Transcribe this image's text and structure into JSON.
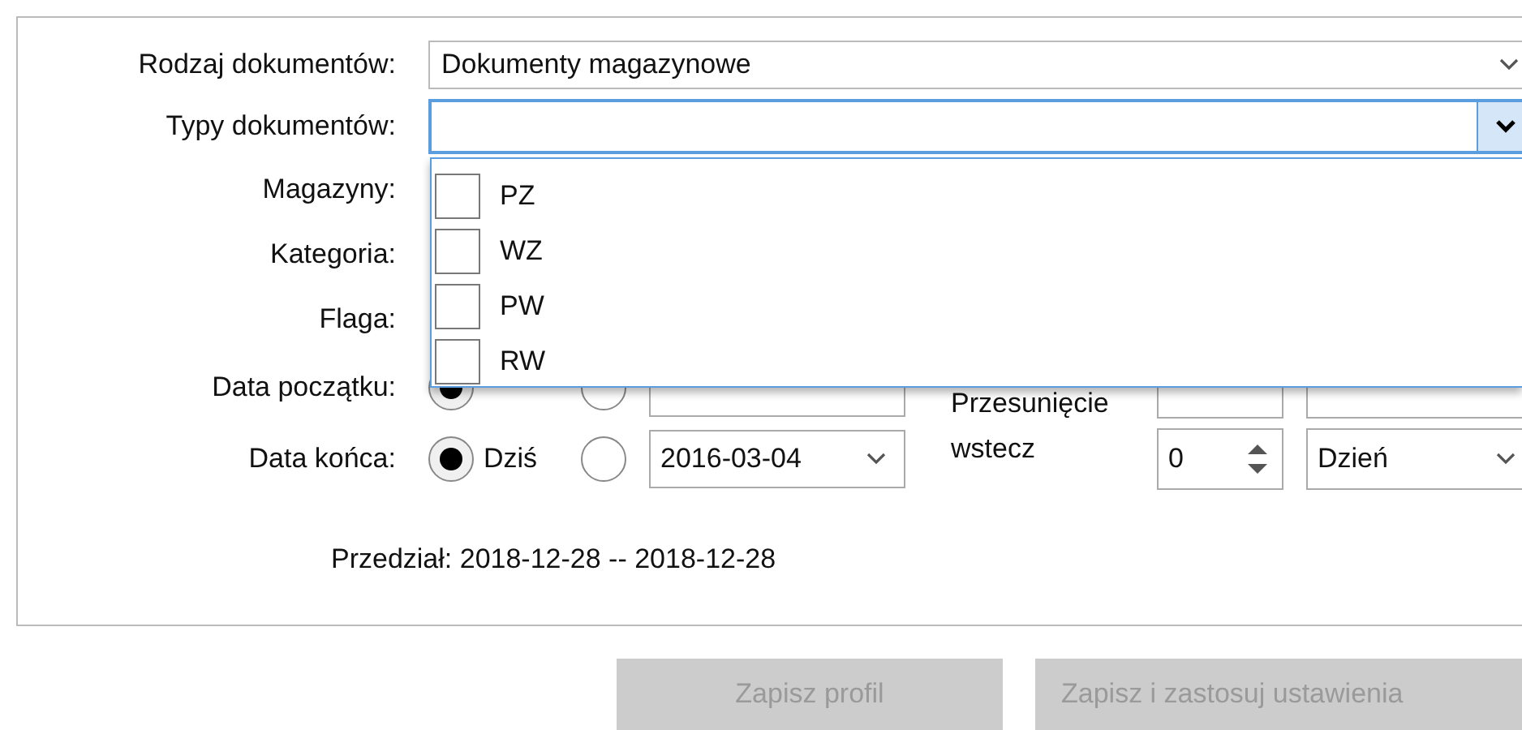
{
  "document_kind": {
    "label": "Rodzaj dokumentów:",
    "value": "Dokumenty magazynowe"
  },
  "document_types": {
    "label": "Typy dokumentów:",
    "expanded": true,
    "options": [
      {
        "label": "PZ",
        "checked": false
      },
      {
        "label": "WZ",
        "checked": false
      },
      {
        "label": "PW",
        "checked": false
      },
      {
        "label": "RW",
        "checked": false
      }
    ]
  },
  "hidden_rows": [
    "Magazyny:",
    "Kategoria:",
    "Flaga:"
  ],
  "start_date": {
    "label": "Data początku:",
    "radios": [
      {
        "selected": true
      },
      {
        "selected": false
      }
    ]
  },
  "end_date": {
    "label": "Data końca:",
    "radios": [
      {
        "label": "Dziś",
        "selected": true
      },
      {
        "selected": false
      }
    ],
    "date": "2016-03-04"
  },
  "shift": {
    "label": "Przesunięcie wstecz",
    "value": "0",
    "unit": "Dzień"
  },
  "range": "Przedział: 2018-12-28 -- 2018-12-28",
  "buttons": [
    {
      "label": "Zapisz profil",
      "disabled": true
    },
    {
      "label": "Zapisz i zastosuj ustawienia",
      "disabled": true
    }
  ]
}
